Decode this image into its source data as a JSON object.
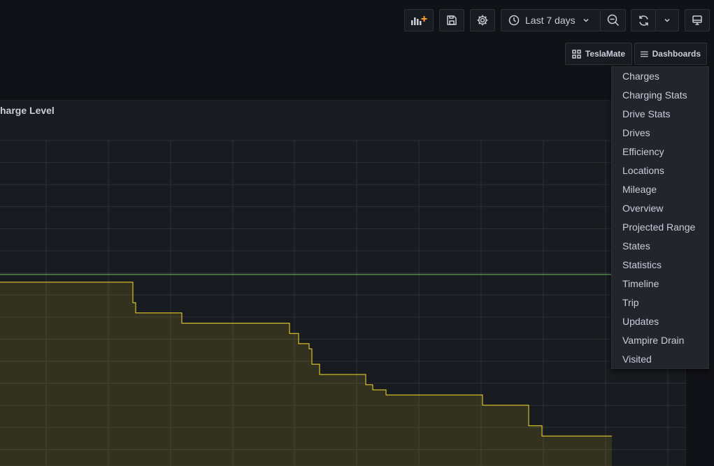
{
  "toolbar": {
    "time_range": "Last 7 days"
  },
  "links": {
    "teslamate_label": "TeslaMate",
    "dashboards_label": "Dashboards"
  },
  "panel": {
    "title": "harge Level"
  },
  "dashboards_menu": [
    "Charges",
    "Charging Stats",
    "Drive Stats",
    "Drives",
    "Efficiency",
    "Locations",
    "Mileage",
    "Overview",
    "Projected Range",
    "States",
    "Statistics",
    "Timeline",
    "Trip",
    "Updates",
    "Vampire Drain",
    "Visited"
  ],
  "icons": {
    "add_panel": "add-panel-icon",
    "save": "save-icon",
    "settings": "gear-icon",
    "clock": "clock-icon",
    "zoom_out": "zoom-out-icon",
    "refresh": "refresh-icon",
    "tv_mode": "monitor-icon"
  },
  "colors": {
    "background": "#111217",
    "panel": "#181b1f",
    "series_yellow": "#fade2a",
    "series_green": "#73bf69"
  },
  "chart_data": {
    "type": "line",
    "title": "harge Level",
    "series": [
      {
        "color": "#fade2a",
        "x": [
          0,
          187,
          190,
          194,
          257,
          260,
          411,
          414,
          427,
          442,
          446,
          457,
          520,
          523,
          533,
          552,
          676,
          690,
          754,
          756,
          775,
          875
        ],
        "values": [
          71,
          71,
          67,
          65,
          65,
          63,
          63,
          61,
          59,
          58,
          55,
          53,
          53,
          51,
          50,
          49,
          49,
          47,
          47,
          43,
          41,
          41
        ]
      },
      {
        "color": "#73bf69",
        "x": [
          0,
          166,
          875
        ],
        "values": [
          72.5,
          72.5,
          75
        ]
      }
    ]
  }
}
